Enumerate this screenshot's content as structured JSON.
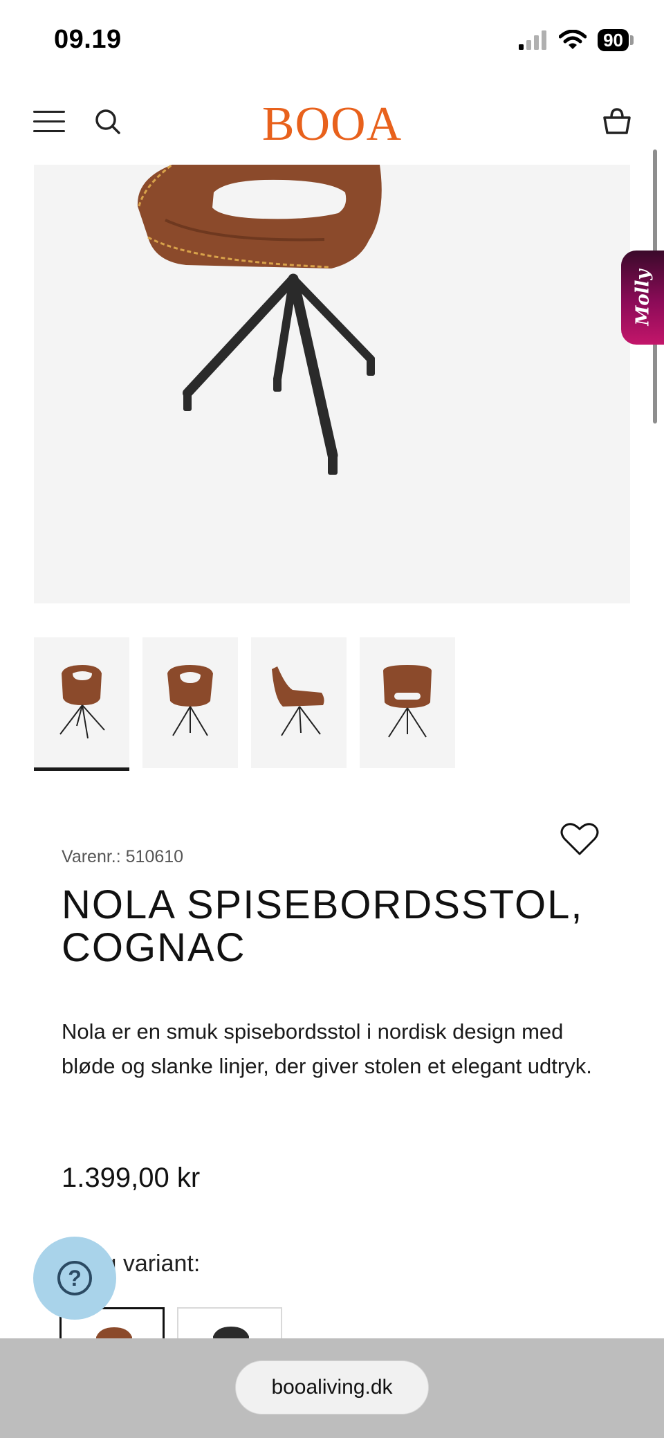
{
  "status_bar": {
    "time": "09.19",
    "battery": "90"
  },
  "header": {
    "logo": "BOOA"
  },
  "molly": {
    "label": "Molly"
  },
  "product": {
    "sku_label": "Varenr.: 510610",
    "title": "NOLA SPISEBORDSSTOL, COGNAC",
    "description": "Nola er en smuk spisebordsstol i nordisk design med bløde og slanke linjer, der giver stolen et elegant udtryk.",
    "price": "1.399,00 kr",
    "variant_label": "Vælg variant:"
  },
  "thumbnails": [
    {
      "view": "front-angle",
      "active": true
    },
    {
      "view": "front",
      "active": false
    },
    {
      "view": "side",
      "active": false
    },
    {
      "view": "back",
      "active": false
    }
  ],
  "variants": [
    {
      "color": "cognac",
      "hex": "#8b4a2b",
      "selected": true
    },
    {
      "color": "black",
      "hex": "#2b2b2b",
      "selected": false
    }
  ],
  "help": {
    "icon": "?"
  },
  "browser": {
    "url": "booaliving.dk"
  },
  "colors": {
    "brand": "#e8611c",
    "leather": "#8b4a2b",
    "help_bubble": "#a9d3ea"
  }
}
